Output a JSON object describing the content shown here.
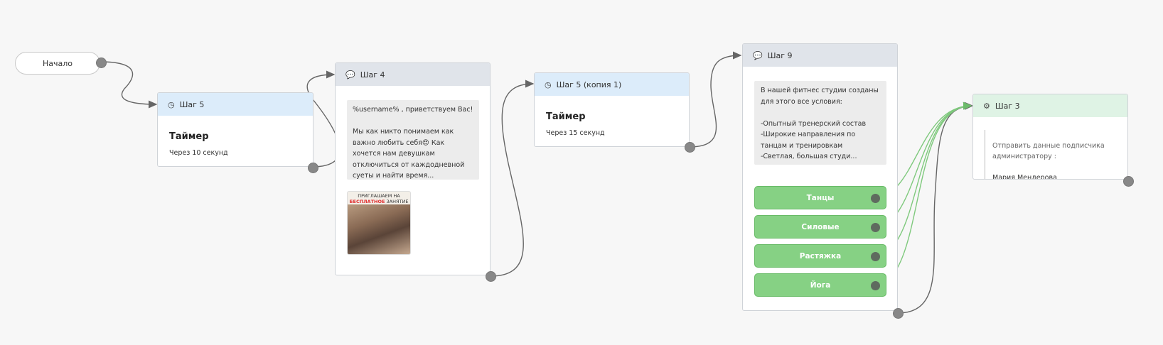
{
  "start": {
    "label": "Начало"
  },
  "step5": {
    "title": "Шаг 5",
    "timer_title": "Таймер",
    "timer_sub": "Через 10 секунд"
  },
  "step4": {
    "title": "Шаг 4",
    "message": "%username% , приветствуем Вас!\n\nМы как никто понимаем как важно любить себя😍 Как хочется нам девушкам отключиться от каждодневной суеты и найти время...",
    "image_caption_top": "ПРИГЛАШАЕМ НА",
    "image_caption_red": "БЕСПЛАТНОЕ",
    "image_caption_rest": " ЗАНЯТИЕ"
  },
  "step5copy": {
    "title": "Шаг 5 (копия 1)",
    "timer_title": "Таймер",
    "timer_sub": "Через 15 секунд"
  },
  "step9": {
    "title": "Шаг 9",
    "message": "В нашей фитнес студии созданы для этого все условия:\n\n-Опытный тренерский состав\n-Широкие направления по танцам и тренировкам\n-Светлая, большая студи...",
    "buttons": [
      {
        "label": "Танцы"
      },
      {
        "label": "Силовые"
      },
      {
        "label": "Растяжка"
      },
      {
        "label": "Йога"
      }
    ]
  },
  "step3": {
    "title": "Шаг 3",
    "text": "Отправить данные подписчика администратору :",
    "recipient": "Мария Мендерова"
  },
  "colors": {
    "timer_header": "#dcecfa",
    "message_header": "#e0e4ea",
    "action_header": "#dff3e5",
    "button_green": "#86d184",
    "wire_gray": "#666666",
    "wire_green": "#7fc97d"
  },
  "icons": {
    "timer": "clock-icon",
    "message": "speech-bubble-icon",
    "action": "gears-icon"
  }
}
